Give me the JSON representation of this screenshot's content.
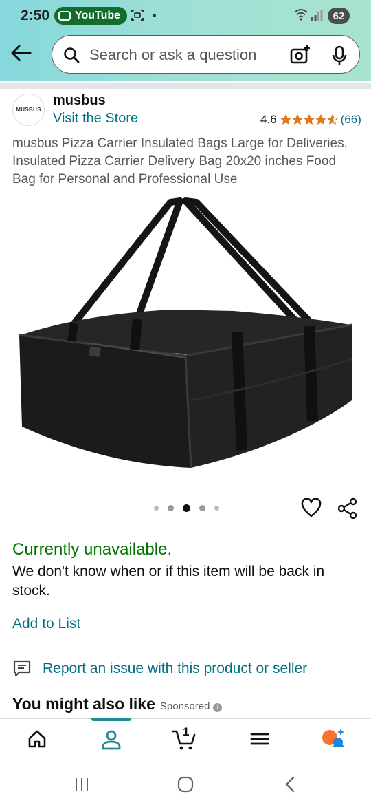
{
  "status_bar": {
    "time": "2:50",
    "notification_app": "YouTube",
    "battery": "62"
  },
  "search": {
    "placeholder": "Search or ask a question"
  },
  "brand": {
    "logo_text": "MUSBUS",
    "name": "musbus",
    "visit_store": "Visit the Store",
    "rating": "4.6",
    "stars": 4.6,
    "review_count": "(66)"
  },
  "product": {
    "title": "musbus Pizza Carrier Insulated Bags Large for Deliveries, Insulated Pizza Carrier Delivery Bag 20x20 inches Food Bag for Personal and Professional Use",
    "image_count": 5,
    "active_image_index": 2
  },
  "availability": {
    "status": "Currently unavailable.",
    "message": "We don't know when or if this item will be back in stock."
  },
  "actions": {
    "add_to_list": "Add to List",
    "report": "Report an issue with this product or seller"
  },
  "recommendations": {
    "heading": "You might also like",
    "sponsored": "Sponsored",
    "info_glyph": "i"
  },
  "bottom_nav": {
    "cart_count": "1",
    "active_tab": "account"
  },
  "colors": {
    "link": "#007185",
    "available_green": "#007600",
    "star": "#de7921",
    "active_tab": "#1f8a93"
  }
}
